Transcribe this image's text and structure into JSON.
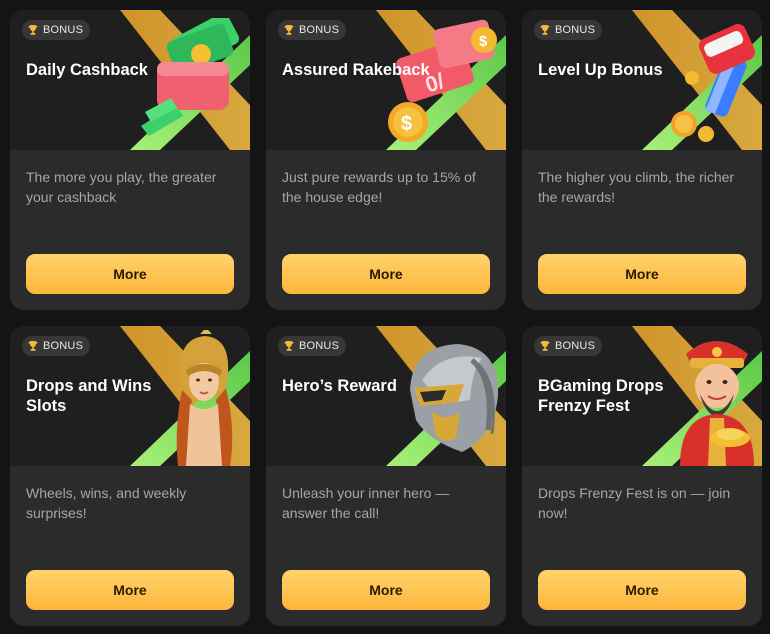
{
  "colors": {
    "page_background": "#141414",
    "card_background": "#2b2b2b",
    "banner_background": "#1f1f1f",
    "x_accent_gold": "#d99a2b",
    "x_accent_green": "#7ee06b",
    "button_gradient_top": "#ffd46b",
    "button_gradient_bottom": "#fcb53a"
  },
  "cards": [
    {
      "badge_icon": "trophy-icon",
      "badge": "BONUS",
      "title": "Daily Cashback",
      "description": "The more you play, the greater your cashback",
      "button": "More",
      "art": "cash-wallet-illustration"
    },
    {
      "badge_icon": "trophy-icon",
      "badge": "BONUS",
      "title": "Assured Rakeback",
      "description": "Just pure rewards up to 15% of the house edge!",
      "button": "More",
      "art": "coupon-coins-illustration"
    },
    {
      "badge_icon": "trophy-icon",
      "badge": "BONUS",
      "title": "Level Up Bonus",
      "description": "The higher you climb, the richer the rewards!",
      "button": "More",
      "art": "gift-rocket-illustration"
    },
    {
      "badge_icon": "trophy-icon",
      "badge": "BONUS",
      "title": "Drops and Wins Slots",
      "description": "Wheels, wins, and weekly surprises!",
      "button": "More",
      "art": "warrior-woman-illustration"
    },
    {
      "badge_icon": "trophy-icon",
      "badge": "BONUS",
      "title": "Hero’s Reward",
      "description": "Unleash your inner hero — answer the call!",
      "button": "More",
      "art": "hero-helmet-illustration"
    },
    {
      "badge_icon": "trophy-icon",
      "badge": "BONUS",
      "title": "BGaming Drops Frenzy Fest",
      "description": "Drops Frenzy Fest is on — join now!",
      "button": "More",
      "art": "fortune-god-illustration"
    }
  ]
}
